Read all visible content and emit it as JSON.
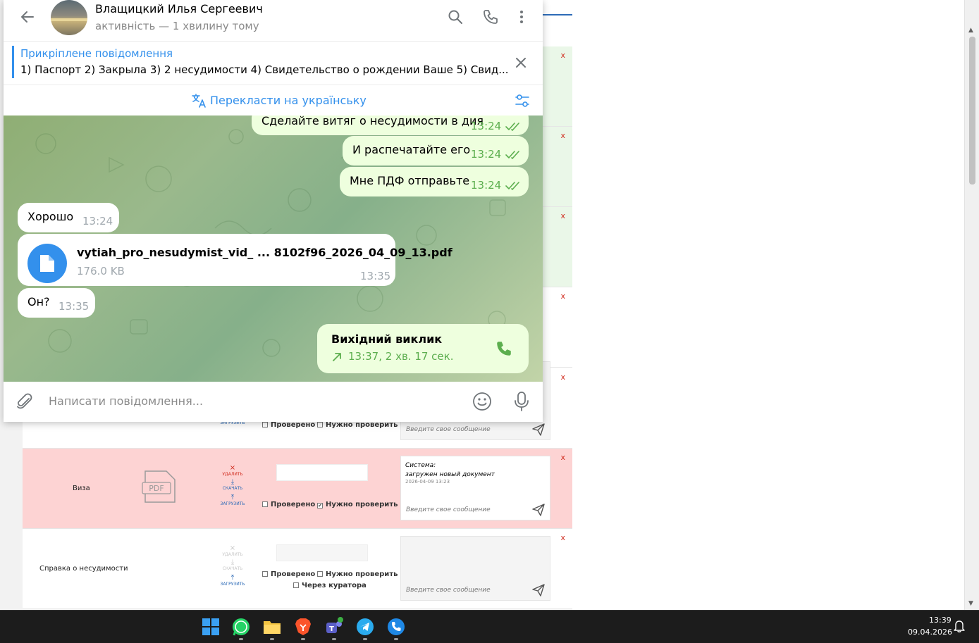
{
  "telegram": {
    "contact_name": "Влащицкий Илья Сергеевич",
    "contact_status": "активність — 1 хвилину тому",
    "pinned_title": "Прикріплене повідомлення",
    "pinned_text": "1) Паспорт 2) Закрыла 3) 2 несудимости 4) Свидетельство о рождении Ваше 5) Свид...",
    "translate_label": "Перекласти на українську",
    "messages": [
      {
        "text": "Сделайте витяг о несудимости в дия",
        "time": "13:24",
        "direction": "out"
      },
      {
        "text": "И распечатайте его",
        "time": "13:24",
        "direction": "out"
      },
      {
        "text": "Мне ПДФ отправьте",
        "time": "13:24",
        "direction": "out"
      },
      {
        "text": "Хорошо",
        "time": "13:24",
        "direction": "in"
      },
      {
        "file_name": "vytiah_pro_nesudymist_vid_ ... 8102f96_2026_04_09_13.pdf",
        "file_size": "176.0 KB",
        "time": "13:35",
        "direction": "in"
      },
      {
        "text": "Он?",
        "time": "13:35",
        "direction": "in"
      },
      {
        "call_title": "Вихідний виклик",
        "call_meta": "13:37, 2 хв. 17 сек.",
        "direction": "out"
      }
    ],
    "composer_placeholder": "Написати повідомлення...",
    "accent_color": "#3390ec",
    "outgoing_bubble_color": "#eeffde"
  },
  "background_page": {
    "rows": [
      {
        "status": "green"
      },
      {
        "status": "green"
      },
      {
        "status": "green"
      },
      {
        "status": "white"
      },
      {
        "status": "white",
        "checks": [
          {
            "label": "Проверено",
            "checked": false
          },
          {
            "label": "Нужно проверить",
            "checked": false
          }
        ],
        "message_placeholder": "Введите свое сообщение",
        "actions": [
          "ЗАГРУЗИТЬ"
        ]
      },
      {
        "status": "red",
        "doc_name": "Виза",
        "actions": [
          "УДАЛИТЬ",
          "СКАЧАТЬ",
          "ЗАГРУЗИТЬ"
        ],
        "checks": [
          {
            "label": "Проверено",
            "checked": false
          },
          {
            "label": "Нужно проверить",
            "checked": true
          }
        ],
        "system_label": "Система:",
        "system_text": "загружен новый документ",
        "system_date": "2026-04-09 13:23",
        "message_placeholder": "Введите свое сообщение"
      },
      {
        "status": "white",
        "doc_name": "Справка о несудимости",
        "actions": [
          "УДАЛИТЬ",
          "СКАЧАТЬ",
          "ЗАГРУЗИТЬ"
        ],
        "checks": [
          {
            "label": "Проверено",
            "checked": false
          },
          {
            "label": "Нужно проверить",
            "checked": false
          },
          {
            "label": "Через куратора",
            "checked": false
          }
        ],
        "message_placeholder": "Введите свое сообщение"
      }
    ],
    "delete_mark": "x"
  },
  "taskbar": {
    "apps": [
      "windows-start-icon",
      "whatsapp-icon",
      "file-explorer-icon",
      "brave-icon",
      "teams-icon",
      "telegram-icon",
      "phone-app-icon"
    ],
    "time": "13:39",
    "date": "09.04.2026"
  }
}
